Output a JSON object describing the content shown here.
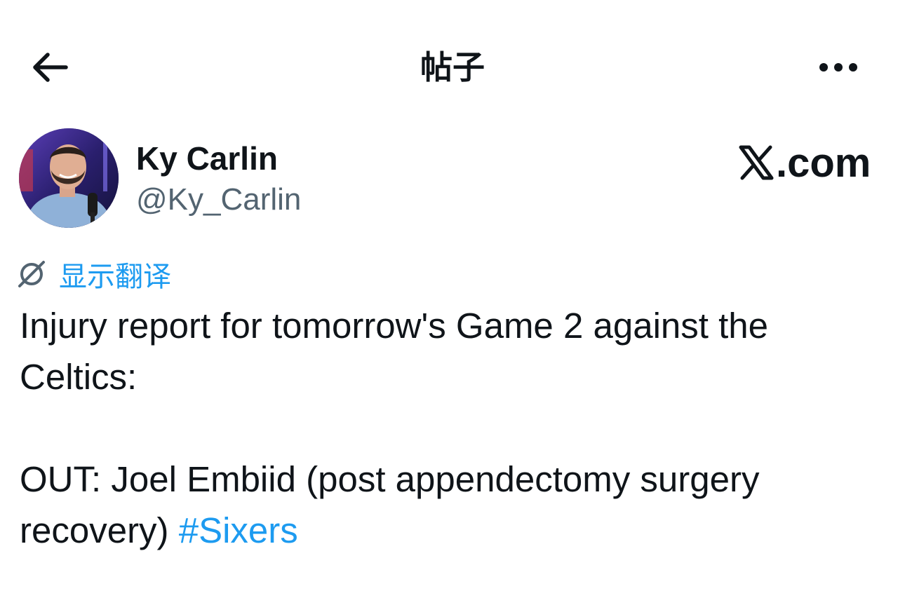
{
  "header": {
    "title": "帖子",
    "back_icon": "arrow-left-icon",
    "more_icon": "more-horizontal-icon"
  },
  "author": {
    "display_name": "Ky Carlin",
    "handle": "@Ky_Carlin"
  },
  "brand": {
    "text": ".com",
    "icon": "x-logo-icon"
  },
  "translate": {
    "label": "显示翻译",
    "icon": "globe-slash-icon"
  },
  "tweet": {
    "line1": "Injury report for tomorrow's Game 2 against the",
    "line2": "Celtics:",
    "line3": "OUT: Joel Embiid (post appendectomy surgery",
    "line4": "recovery) ",
    "hashtag": "#Sixers"
  },
  "colors": {
    "text_primary": "#0f1419",
    "text_secondary": "#536471",
    "accent": "#1d9bf0"
  }
}
